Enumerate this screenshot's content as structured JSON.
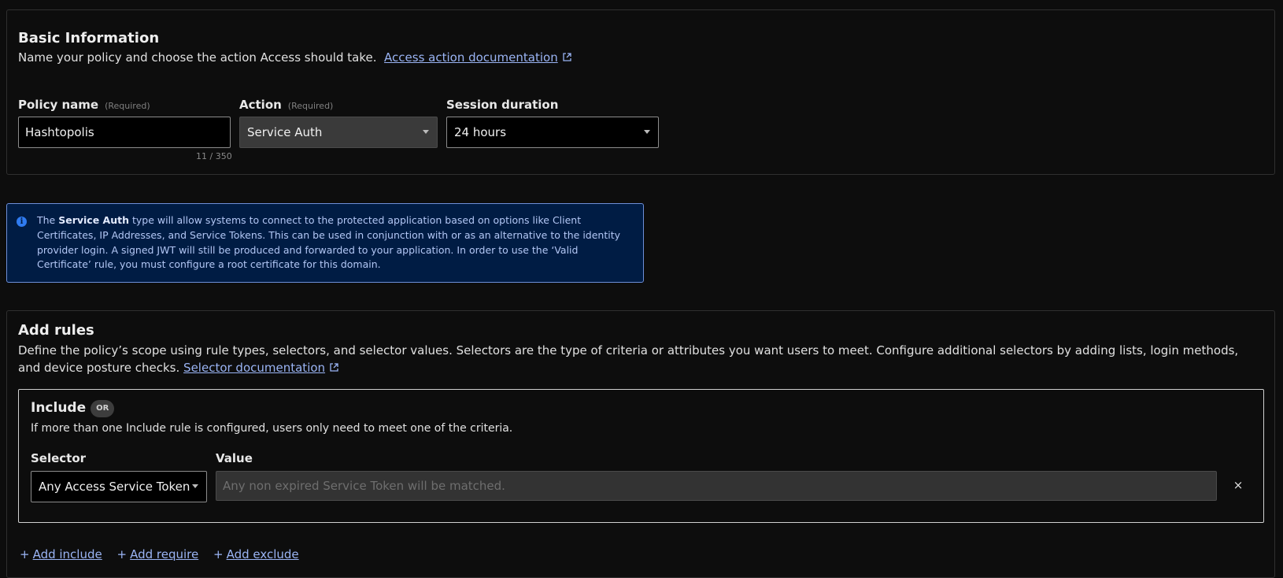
{
  "basic": {
    "title": "Basic Information",
    "description": "Name your policy and choose the action Access should take.",
    "doc_link": "Access action documentation",
    "policy_name": {
      "label": "Policy name",
      "required": "(Required)",
      "value": "Hashtopolis",
      "counter": "11 / 350"
    },
    "action": {
      "label": "Action",
      "required": "(Required)",
      "value": "Service Auth"
    },
    "session": {
      "label": "Session duration",
      "value": "24 hours"
    }
  },
  "info": {
    "text_before": "The ",
    "bold": "Service Auth",
    "text_after": " type will allow systems to connect to the protected application based on options like Client Certificates, IP Addresses, and Service Tokens. This can be used in conjunction with or as an alternative to the identity provider login. A signed JWT will still be produced and forwarded to your application. In order to use the ‘Valid Certificate’ rule, you must configure a root certificate for this domain."
  },
  "rules": {
    "title": "Add rules",
    "description": "Define the policy’s scope using rule types, selectors, and selector values. Selectors are the type of criteria or attributes you want users to meet. Configure additional selectors by adding lists, login methods, and device posture checks.",
    "doc_link": "Selector documentation",
    "include": {
      "title": "Include",
      "badge": "OR",
      "description": "If more than one Include rule is configured, users only need to meet one of the criteria.",
      "selector_label": "Selector",
      "value_label": "Value",
      "selector_value": "Any Access Service Token",
      "value_placeholder": "Any non expired Service Token will be matched.",
      "remove": "×"
    },
    "add_include": "Add include",
    "add_require": "Add require",
    "add_exclude": "Add exclude"
  },
  "colors": {
    "link": "#9ab4f4",
    "info_bg": "#001c44",
    "info_border": "#6e8fd8"
  }
}
